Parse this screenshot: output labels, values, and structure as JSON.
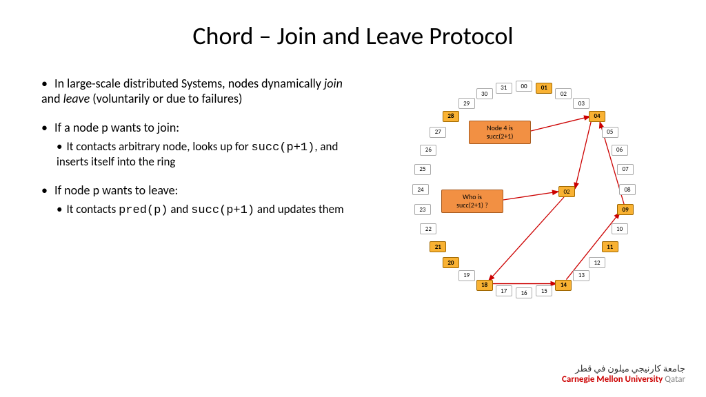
{
  "title": "Chord – Join and Leave Protocol",
  "bullets": {
    "b1_pre": "In large-scale distributed Systems, nodes dynamically ",
    "b1_em1": "join",
    "b1_mid": " and ",
    "b1_em2": "leave",
    "b1_post": " (voluntarily or due to failures)",
    "b2": "If a node p wants to join:",
    "b2a_pre": "It contacts arbitrary node, looks up for ",
    "b2a_code": "succ(p+1)",
    "b2a_post": ", and inserts itself into the ring",
    "b3": "If node p wants to leave:",
    "b3a_pre": "It contacts ",
    "b3a_code1": "pred(p)",
    "b3a_mid": "  and ",
    "b3a_code2": "succ(p+1)",
    "b3a_post": " and updates them"
  },
  "ring": {
    "labels": [
      "00",
      "01",
      "02",
      "03",
      "04",
      "05",
      "06",
      "07",
      "08",
      "09",
      "10",
      "11",
      "12",
      "13",
      "14",
      "15",
      "16",
      "17",
      "18",
      "19",
      "20",
      "21",
      "22",
      "23",
      "24",
      "25",
      "26",
      "27",
      "28",
      "29",
      "30",
      "31"
    ],
    "highlighted": [
      1,
      4,
      9,
      11,
      14,
      18,
      20,
      21,
      28
    ]
  },
  "callouts": {
    "top": "Node 4 is\nsucc(2+1)",
    "bottom": "Who is\nsucc(2+1) ?"
  },
  "inner_node": "02",
  "footer": {
    "arabic": "جامعة كارنيجي ميلون في قطر",
    "en1": "Carnegie Mellon University",
    "en2": " Qatar"
  }
}
